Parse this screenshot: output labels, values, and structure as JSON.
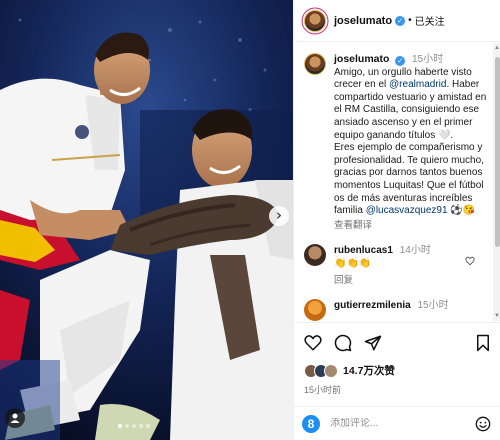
{
  "header": {
    "username": "joselumato",
    "separator": "•",
    "follow_state": "已关注"
  },
  "caption": {
    "username": "joselumato",
    "time": "15小时",
    "segments": {
      "s1": "Amigo, un orgullo haberte visto crecer en el ",
      "mention1": "@realmadrid",
      "s2": ". Haber compartido vestuario y amistad en el RM Castilla, consiguiendo ese ansiado ascenso y en el primer equipo ganando títulos 🤍.",
      "p2": "Eres ejemplo de compañerismo y profesionalidad. Te quiero mucho, gracias por darnos tantos buenos momentos Luquitas! Que el fútbol os de más aventuras increíbles familia ",
      "mention2": "@lucasvazquez91",
      "emojis": " ⚽😘"
    },
    "translate_label": "查看翻译"
  },
  "comments": [
    {
      "username": "rubenlucas1",
      "time": "14小时",
      "text": "👏👏👏",
      "reply_label": "回复"
    },
    {
      "username": "gutierrezmilenia",
      "time": "15小时",
      "text": "",
      "reply_label": ""
    }
  ],
  "stats": {
    "likes": "14.7万次赞",
    "post_time": "15小时前"
  },
  "add_comment": {
    "placeholder": "添加评论...",
    "emoji_button_label": "8"
  },
  "photo": {
    "next_label": "›",
    "dots_total": 5,
    "dots_active": 0
  },
  "colors": {
    "accent_blue": "#3897f0",
    "mention": "#00376b",
    "muted": "#737373",
    "photo_bg": "#0d1a3c"
  }
}
